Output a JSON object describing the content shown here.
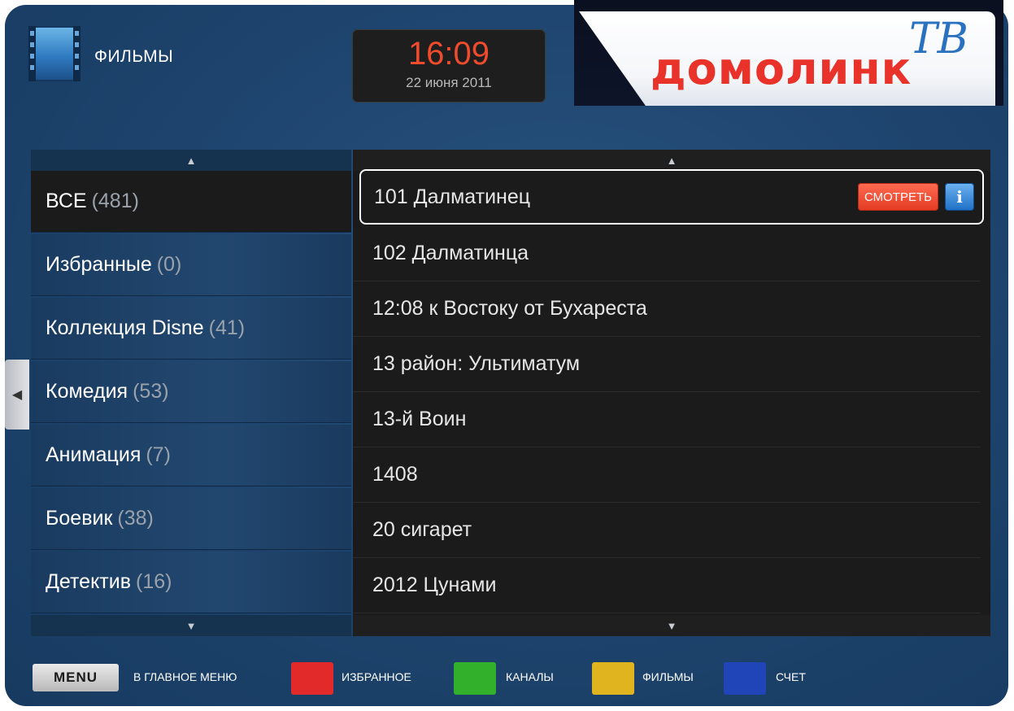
{
  "header": {
    "section_title": "ФИЛЬМЫ",
    "section_icon": "film-icon",
    "clock_time": "16:09",
    "clock_date": "22 июня 2011",
    "logo_text": "домолинк",
    "logo_tv": "ТВ"
  },
  "categories": [
    {
      "label": "ВСЕ",
      "count": "(481)",
      "selected": true
    },
    {
      "label": "Избранные",
      "count": "(0)"
    },
    {
      "label": "Коллекция Disne",
      "count": "(41)"
    },
    {
      "label": "Комедия",
      "count": "(53)"
    },
    {
      "label": "Анимация",
      "count": "(7)"
    },
    {
      "label": "Боевик",
      "count": "(38)"
    },
    {
      "label": "Детектив",
      "count": "(16)"
    }
  ],
  "films": [
    {
      "title": "101 Далматинец",
      "selected": true
    },
    {
      "title": "102 Далматинца"
    },
    {
      "title": "12:08 к Востоку от Бухареста"
    },
    {
      "title": "13 район: Ультиматум"
    },
    {
      "title": "13-й Воин"
    },
    {
      "title": "1408"
    },
    {
      "title": "20 сигарет"
    },
    {
      "title": "2012 Цунами"
    }
  ],
  "actions": {
    "watch_label": "СМОТРЕТЬ",
    "info_label": "i"
  },
  "bottom_bar": {
    "menu_key": "MENU",
    "main_menu_label": "В ГЛАВНОЕ МЕНЮ",
    "red_label": "ИЗБРАННОЕ",
    "green_label": "КАНАЛЫ",
    "yellow_label": "ФИЛЬМЫ",
    "blue_label": "СЧЕТ"
  },
  "colors": {
    "red": "#e32a2a",
    "green": "#33b02b",
    "yellow": "#e0b41e",
    "blue": "#1f45b8"
  }
}
